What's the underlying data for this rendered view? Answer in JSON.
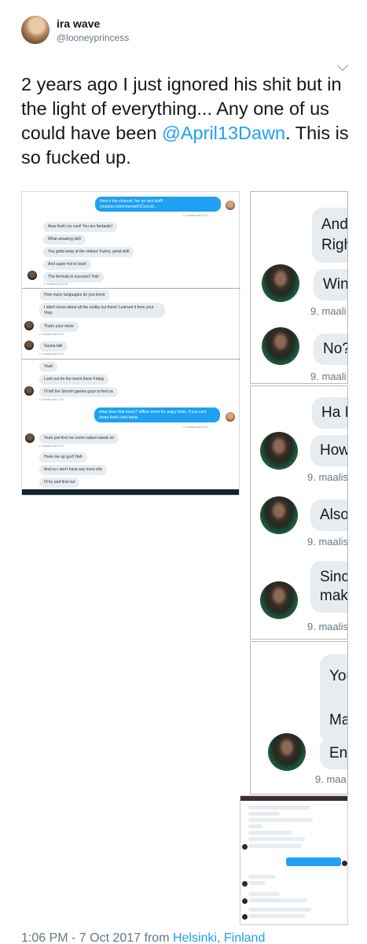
{
  "user": {
    "display_name": "ira wave",
    "handle": "@looneyprincess"
  },
  "tweet": {
    "text_before": "2 years ago I just ignored his shit but in the light of everything... Any one of us could have been ",
    "mention": "@April13Dawn",
    "text_after": ". This is so fucked up."
  },
  "screenshot1": {
    "messages": [
      {
        "dir": "out",
        "text": "Here's the channel, fan art and stuff! youtube.com/channel/UCsvUxI..."
      },
      {
        "dir": "ts",
        "text": "9. maaliskuuta 2015 ✓"
      },
      {
        "dir": "in",
        "text": "Aww that's so cool! You are fantastic!"
      },
      {
        "dir": "in",
        "text": "What amazing skill"
      },
      {
        "dir": "in",
        "text": "You gotta keep at the videos! Funny, great skill"
      },
      {
        "dir": "in",
        "text": "And super hot to boot!"
      },
      {
        "dir": "in",
        "text": "The formula to success!! Hah"
      },
      {
        "dir": "ts",
        "text": "9. maaliskuuta 2015"
      },
      {
        "dir": "in",
        "text": "How many languages do you know"
      },
      {
        "dir": "in",
        "text": "I didn't know about all the nudity out there! Learned it from your Vlog"
      },
      {
        "dir": "in",
        "text": "That's your show"
      },
      {
        "dir": "ts",
        "text": "9. maaliskuuta 2015"
      },
      {
        "dir": "in",
        "text": "Sauna talk"
      },
      {
        "dir": "ts",
        "text": "9. maaliskuuta 2015"
      },
      {
        "dir": "in",
        "text": "Yeah"
      },
      {
        "dir": "in",
        "text": "Look out for the event there Friday"
      },
      {
        "dir": "in",
        "text": "I'll tell the Smosh games guys to find ya"
      },
      {
        "dir": "ts",
        "text": "9. maaliskuuta 2015"
      },
      {
        "dir": "out",
        "text": "what does that mean? offline event for angry birds. if you cant share that's cool haha."
      },
      {
        "dir": "ts",
        "text": "9. maaliskuuta 2015 ✓"
      },
      {
        "dir": "in",
        "text": "Yeah just find me some naked sweds lol"
      },
      {
        "dir": "ts",
        "text": "9. maaliskuuta 2015"
      },
      {
        "dir": "in",
        "text": "Hook me up gurl! Hah"
      },
      {
        "dir": "in",
        "text": "And no i don't have any more info"
      },
      {
        "dir": "in",
        "text": "I'll try and find out"
      }
    ]
  },
  "screenshot2": {
    "bubbles": [
      "And",
      "Righ",
      "Win",
      "No?",
      "Ha I'",
      "How",
      "Also",
      "Sinc",
      "mak",
      "You",
      "Ma",
      "Enj"
    ],
    "timestamps": [
      "9. maali",
      "9. maali",
      "9. maalis",
      "9. maalis",
      "9. maalis",
      "9. maa"
    ]
  },
  "footer": {
    "time": "1:06 PM - 7 Oct 2017 from ",
    "location": "Helsinki, Finland"
  }
}
